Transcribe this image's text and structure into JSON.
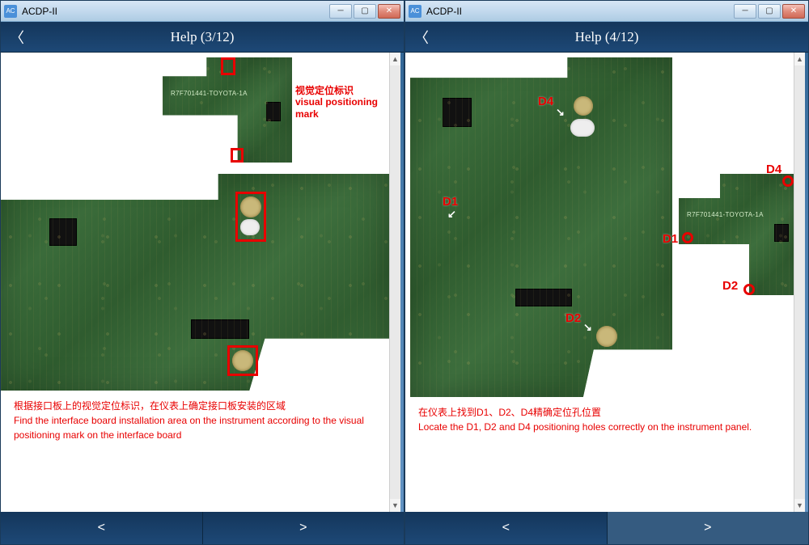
{
  "left": {
    "window_title": "ACDP-II",
    "header_title": "Help (3/12)",
    "annotations": {
      "vp_mark_cn": "视觉定位标识",
      "vp_mark_en": "visual positioning mark",
      "board_label": "R7F701441-TOYOTA-1A"
    },
    "caption_cn": "根据接口板上的视觉定位标识，在仪表上确定接口板安装的区域",
    "caption_en": "Find the interface board installation area on the instrument according to the visual positioning mark on the interface board",
    "nav_prev": "<",
    "nav_next": ">"
  },
  "right": {
    "window_title": "ACDP-II",
    "header_title": "Help (4/12)",
    "annotations": {
      "d1": "D1",
      "d2": "D2",
      "d4": "D4",
      "board_label": "R7F701441-TOYOTA-1A"
    },
    "caption_cn": "在仪表上找到D1、D2、D4精确定位孔位置",
    "caption_en": "Locate the D1, D2 and D4 positioning holes correctly on the instrument panel.",
    "nav_prev": "<",
    "nav_next": ">"
  }
}
